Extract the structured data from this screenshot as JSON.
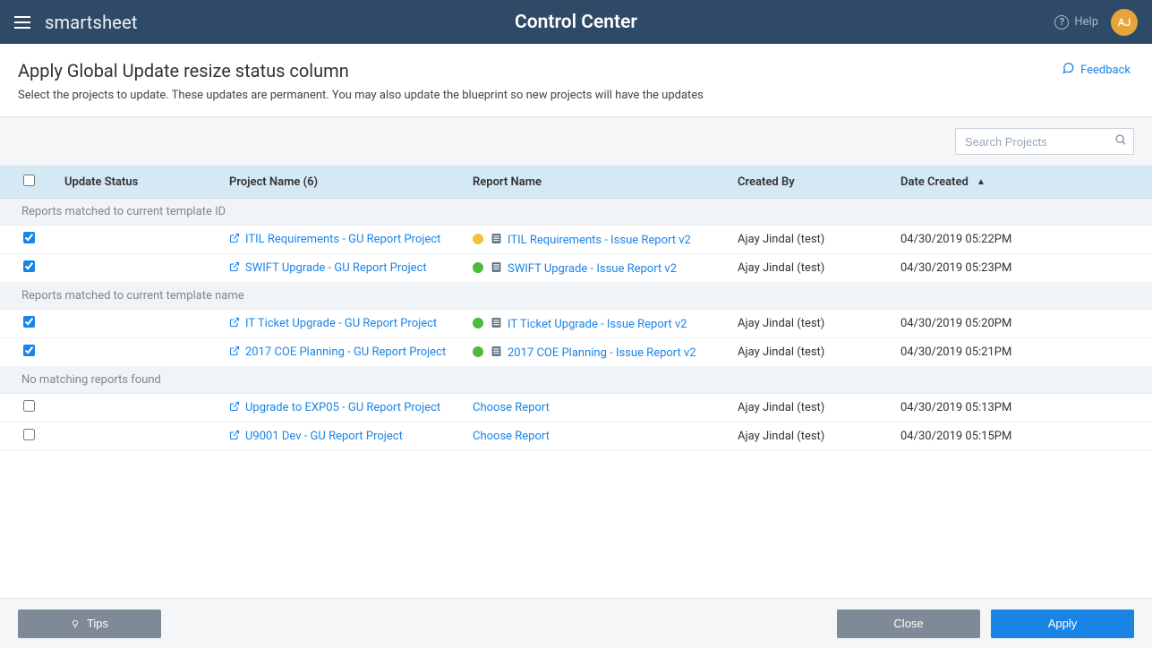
{
  "topbar": {
    "brand": "smartsheet",
    "title": "Control Center",
    "help_label": "Help",
    "avatar_initials": "AJ"
  },
  "page": {
    "title": "Apply Global Update resize status column",
    "subtitle": "Select the projects to update. These updates are permanent. You may also update the blueprint so new projects will have the updates",
    "feedback_label": "Feedback"
  },
  "search": {
    "placeholder": "Search Projects"
  },
  "columns": {
    "update_status": "Update Status",
    "project_name": "Project Name (6)",
    "report_name": "Report Name",
    "created_by": "Created By",
    "date_created": "Date Created"
  },
  "groups": [
    {
      "label": "Reports matched to current template ID",
      "rows": [
        {
          "checked": true,
          "project": "ITIL Requirements - GU Report Project",
          "status_color": "yellow",
          "report": "ITIL Requirements - Issue Report v2",
          "choose": false,
          "created_by": "Ajay Jindal (test)",
          "date": "04/30/2019 05:22PM"
        },
        {
          "checked": true,
          "project": "SWIFT Upgrade - GU Report Project",
          "status_color": "green",
          "report": "SWIFT Upgrade - Issue Report v2",
          "choose": false,
          "created_by": "Ajay Jindal (test)",
          "date": "04/30/2019 05:23PM"
        }
      ]
    },
    {
      "label": "Reports matched to current template name",
      "rows": [
        {
          "checked": true,
          "project": "IT Ticket Upgrade - GU Report Project",
          "status_color": "green",
          "report": "IT Ticket Upgrade - Issue Report v2",
          "choose": false,
          "created_by": "Ajay Jindal (test)",
          "date": "04/30/2019 05:20PM"
        },
        {
          "checked": true,
          "project": "2017 COE Planning - GU Report Project",
          "status_color": "green",
          "report": "2017 COE Planning - Issue Report v2",
          "choose": false,
          "created_by": "Ajay Jindal (test)",
          "date": "04/30/2019 05:21PM"
        }
      ]
    },
    {
      "label": "No matching reports found",
      "rows": [
        {
          "checked": false,
          "project": "Upgrade to EXP05 - GU Report Project",
          "status_color": null,
          "report": "Choose Report",
          "choose": true,
          "created_by": "Ajay Jindal (test)",
          "date": "04/30/2019 05:13PM"
        },
        {
          "checked": false,
          "project": "U9001 Dev - GU Report Project",
          "status_color": null,
          "report": "Choose Report",
          "choose": true,
          "created_by": "Ajay Jindal (test)",
          "date": "04/30/2019 05:15PM"
        }
      ]
    }
  ],
  "footer": {
    "tips": "Tips",
    "close": "Close",
    "apply": "Apply"
  }
}
